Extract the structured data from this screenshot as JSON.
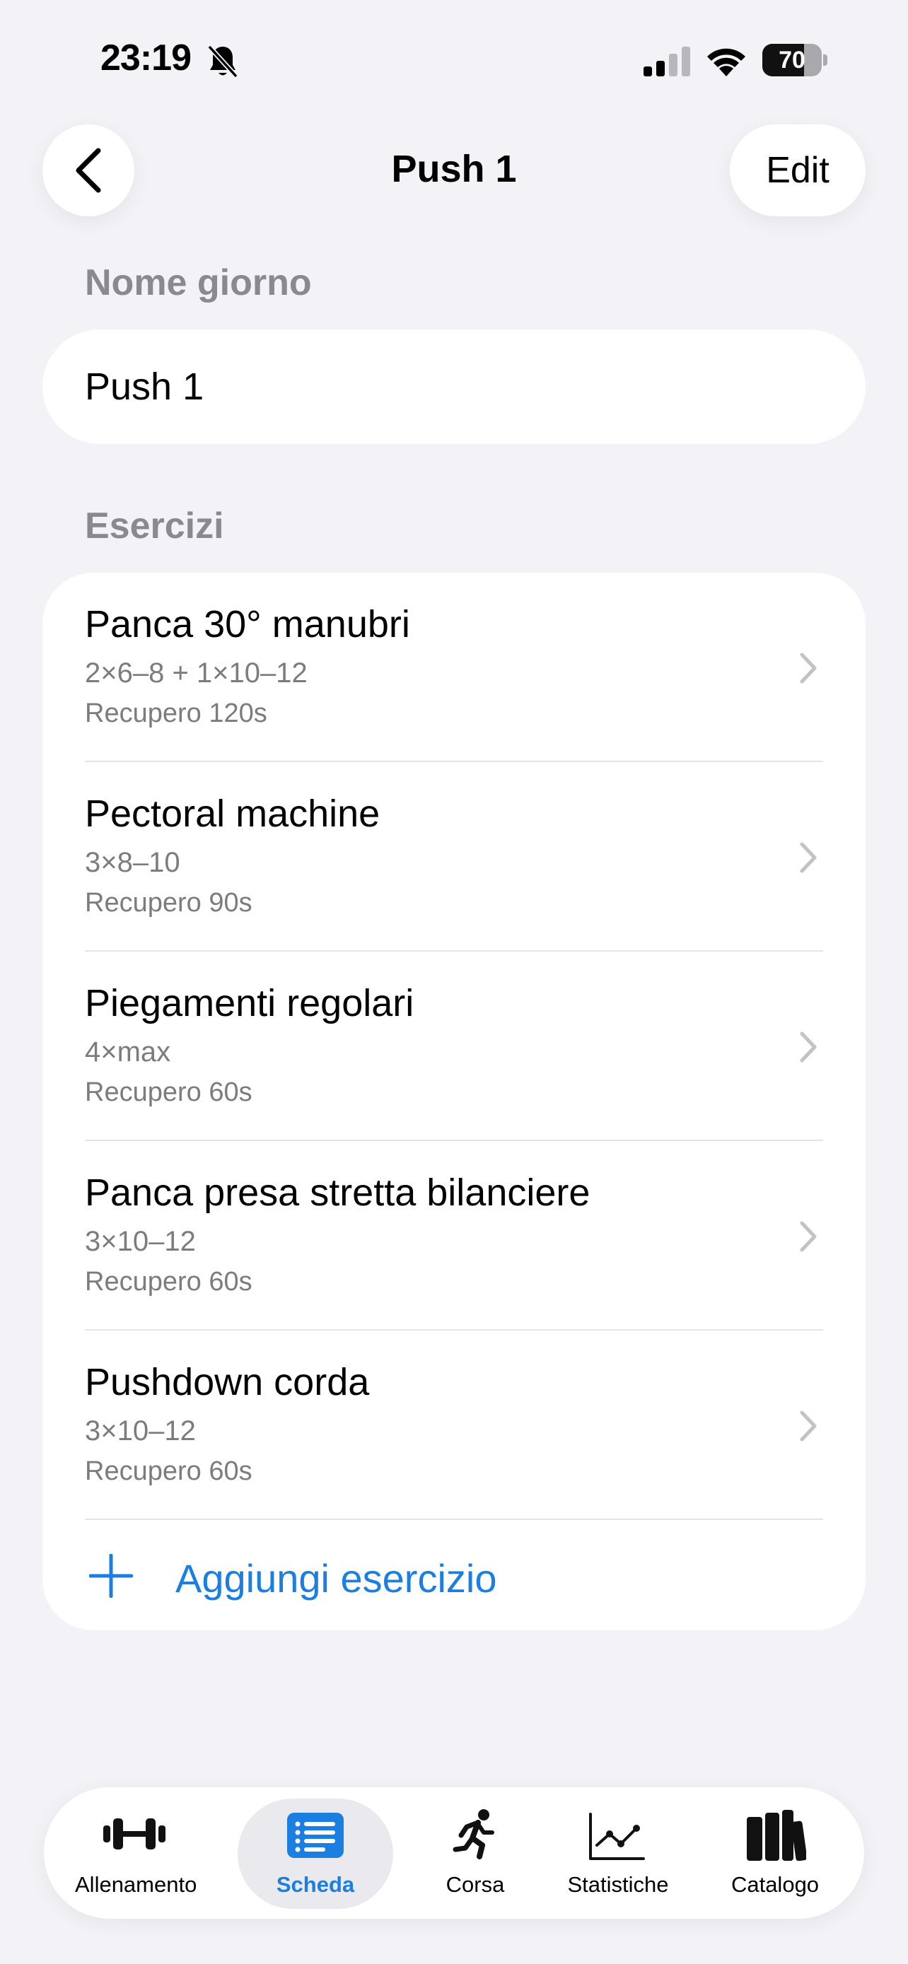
{
  "status_bar": {
    "time": "23:19",
    "battery": "70",
    "battery_level": 0.7
  },
  "nav": {
    "title": "Push 1",
    "edit_label": "Edit"
  },
  "day_name": {
    "section_label": "Nome giorno",
    "value": "Push 1"
  },
  "exercises": {
    "section_label": "Esercizi",
    "items": [
      {
        "name": "Panca 30° manubri",
        "scheme": "2×6–8 + 1×10–12",
        "rest": "Recupero 120s"
      },
      {
        "name": "Pectoral machine",
        "scheme": "3×8–10",
        "rest": "Recupero 90s"
      },
      {
        "name": "Piegamenti regolari",
        "scheme": "4×max",
        "rest": "Recupero 60s"
      },
      {
        "name": "Panca presa stretta bilanciere",
        "scheme": "3×10–12",
        "rest": "Recupero 60s"
      },
      {
        "name": "Pushdown corda",
        "scheme": "3×10–12",
        "rest": "Recupero 60s"
      }
    ],
    "add_label": "Aggiungi esercizio"
  },
  "tabbar": {
    "active": "Scheda",
    "tabs": [
      {
        "label": "Allenamento",
        "icon": "dumbbell-icon"
      },
      {
        "label": "Scheda",
        "icon": "list-icon"
      },
      {
        "label": "Corsa",
        "icon": "running-icon"
      },
      {
        "label": "Statistiche",
        "icon": "chart-icon"
      },
      {
        "label": "Catalogo",
        "icon": "books-icon"
      }
    ]
  },
  "colors": {
    "accent": "#1a7fe0",
    "background": "#f2f2f7",
    "secondary_text": "#7c7c80"
  }
}
